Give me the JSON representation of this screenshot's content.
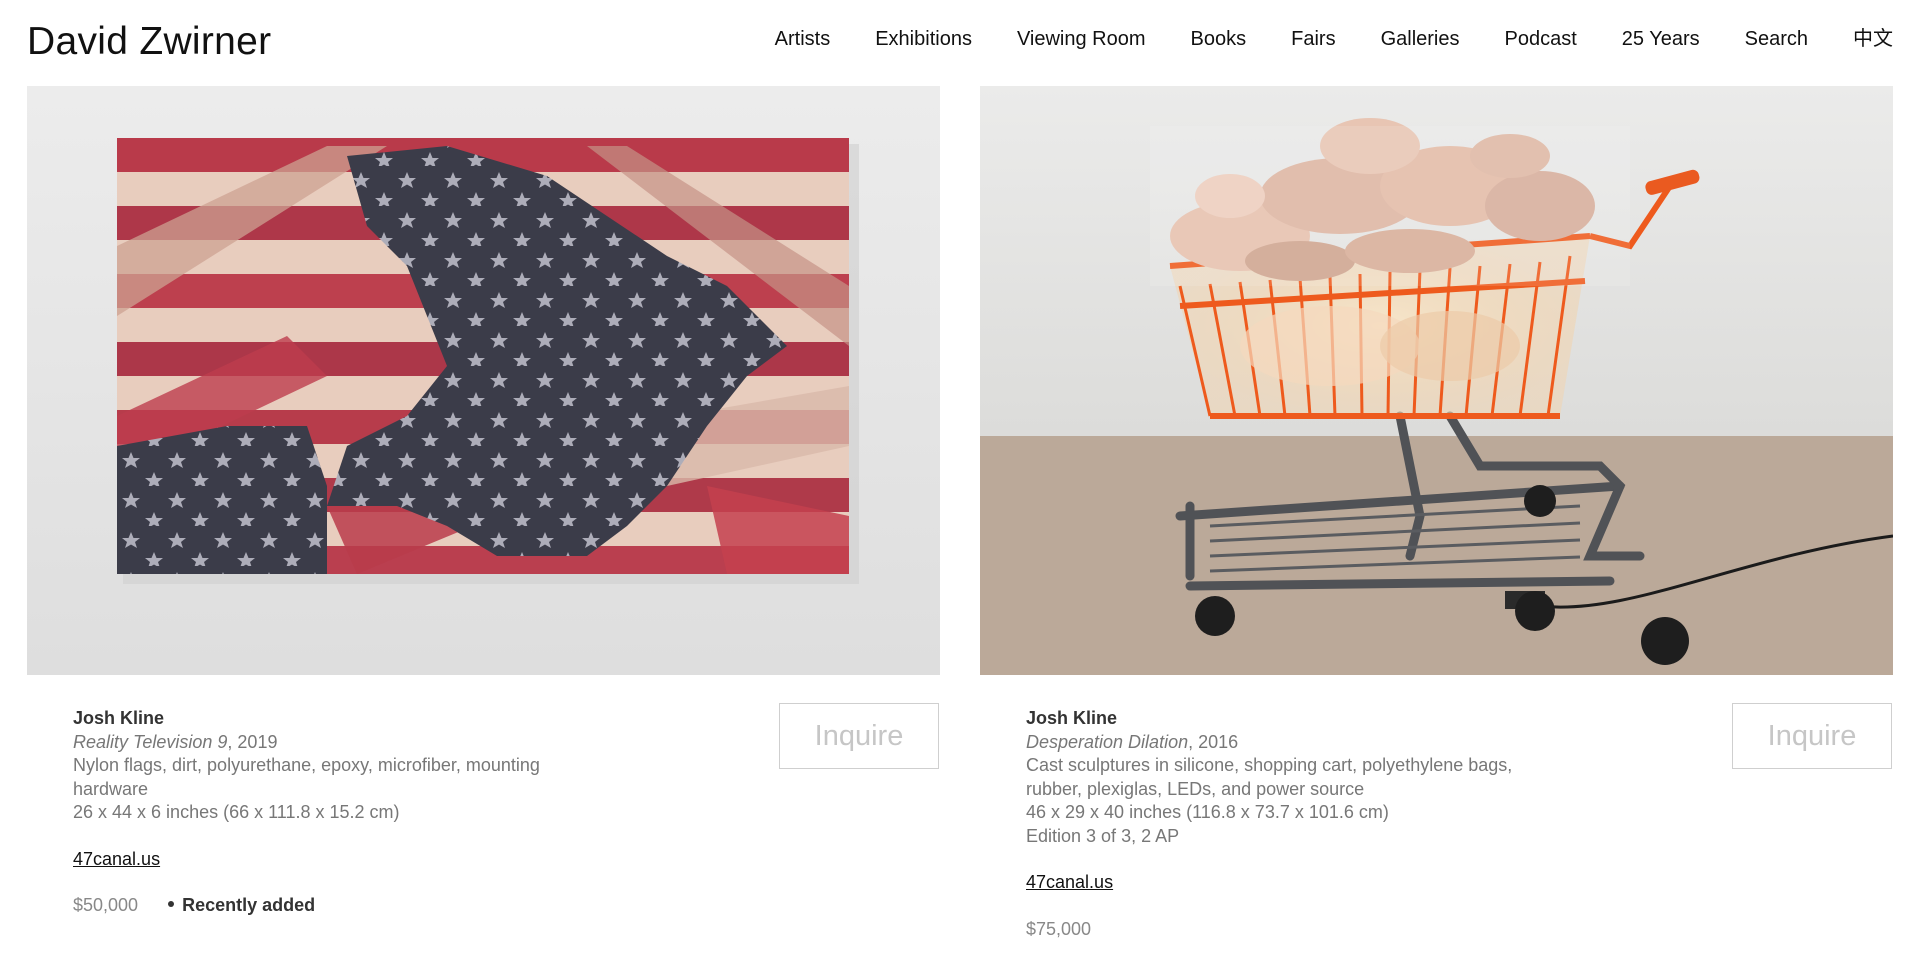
{
  "header": {
    "logo": "David Zwirner",
    "nav": [
      "Artists",
      "Exhibitions",
      "Viewing Room",
      "Books",
      "Fairs",
      "Galleries",
      "Podcast",
      "25 Years",
      "Search",
      "中文"
    ]
  },
  "works": [
    {
      "artist": "Josh Kline",
      "title": "Reality Television 9",
      "year": ", 2019",
      "medium": "Nylon flags, dirt, polyurethane, epoxy, microfiber, mounting hardware",
      "dimensions": "26 x 44 x 6 inches (66 x 111.8 x 15.2 cm)",
      "edition": "",
      "link": "47canal.us",
      "price": "$50,000",
      "badge": "Recently added",
      "inquire": "Inquire",
      "image_icon": "flag-collage-artwork"
    },
    {
      "artist": "Josh Kline",
      "title": "Desperation Dilation",
      "year": ", 2016",
      "medium": "Cast sculptures in silicone, shopping cart, polyethylene bags, rubber, plexiglas, LEDs, and power source",
      "dimensions": "46 x 29 x 40 inches (116.8 x 73.7 x 101.6 cm)",
      "edition": "Edition 3 of 3, 2 AP",
      "link": "47canal.us",
      "price": "$75,000",
      "badge": "",
      "inquire": "Inquire",
      "image_icon": "shopping-cart-sculpture"
    }
  ],
  "colors": {
    "flag_red": "#b22a3a",
    "flag_navy": "#2a2d3c",
    "cart_orange": "#ef5a1e",
    "wall": "#e6e6e4",
    "floor": "#b9a797"
  }
}
